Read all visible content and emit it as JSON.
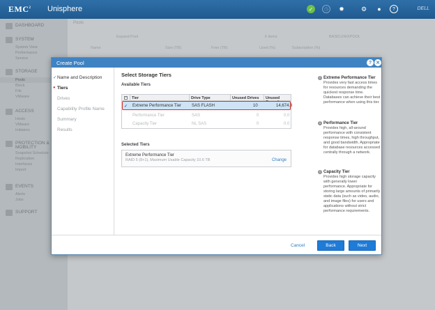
{
  "app": {
    "brand": "EMC",
    "brand_sup": "2",
    "product": "Unisphere",
    "vendor": "DELL"
  },
  "header_icons": [
    "check-icon",
    "clock-icon",
    "gear-icon",
    "user-icon",
    "help-icon"
  ],
  "nav": {
    "dashboard": "DASHBOARD",
    "system": "SYSTEM",
    "system_items": [
      "System View",
      "Performance",
      "Service"
    ],
    "storage": "STORAGE",
    "storage_items": [
      "Pools",
      "Block",
      "File",
      "VMware"
    ],
    "access": "ACCESS",
    "access_items": [
      "Hosts",
      "VMware",
      "Initiators"
    ],
    "protection": "PROTECTION &",
    "protection2": "MOBILITY",
    "protection_items": [
      "Snapshot Schedule",
      "Replication",
      "Interfaces",
      "Import"
    ],
    "events": "EVENTS",
    "events_items": [
      "Alerts",
      "Jobs"
    ],
    "support": "SUPPORT"
  },
  "background": {
    "tab": "Pools",
    "expand": "Expand Pool",
    "items": "6 items",
    "pool_name": "BASICUNIXPOOL",
    "cols": [
      "Name",
      "Size (TB)",
      "Free (TB)",
      "Used (%)",
      "Subscription (%)"
    ]
  },
  "dialog": {
    "title": "Create Pool",
    "steps": [
      {
        "label": "Name and Description",
        "state": "done"
      },
      {
        "label": "Tiers",
        "state": "current"
      },
      {
        "label": "Drives",
        "state": "pending"
      },
      {
        "label": "Capability Profile Name",
        "state": "pending"
      },
      {
        "label": "Summary",
        "state": "pending"
      },
      {
        "label": "Results",
        "state": "pending"
      }
    ],
    "heading": "Select Storage Tiers",
    "available_label": "Available Tiers",
    "columns": [
      "Tier",
      "Drive Type",
      "Unused Drives",
      "Unused Capacity (GB)"
    ],
    "rows": [
      {
        "tier": "Extreme Performance Tier",
        "drive": "SAS FLASH",
        "unused": "10",
        "capacity": "14,674.8",
        "selected": true
      },
      {
        "tier": "Performance Tier",
        "drive": "SAS",
        "unused": "0",
        "capacity": "0.0",
        "selected": false
      },
      {
        "tier": "Capacity Tier",
        "drive": "NL SAS",
        "unused": "0",
        "capacity": "0.0",
        "selected": false
      }
    ],
    "selected_label": "Selected Tiers",
    "selected_tier": {
      "name": "Extreme Performance Tier",
      "detail": "RAID 5 (8+1), Maximum Usable Capacity 10.6 TB",
      "change": "Change"
    },
    "help": [
      {
        "title": "Extreme Performance Tier",
        "text": "Provides very fast access times for resources demanding the quickest response time. Databases can achieve their best performance when using this tier."
      },
      {
        "title": "Performance Tier",
        "text": "Provides high, all-around performance with consistent response times, high throughput, and good bandwidth. Appropriate for database resources accessed centrally through a network."
      },
      {
        "title": "Capacity Tier",
        "text": "Provides high storage capacity with generally lower performance. Appropriate for storing large amounts of primarily static data (such as video, audio, and image files) for users and applications without strict performance requirements."
      }
    ],
    "buttons": {
      "cancel": "Cancel",
      "back": "Back",
      "next": "Next"
    }
  }
}
